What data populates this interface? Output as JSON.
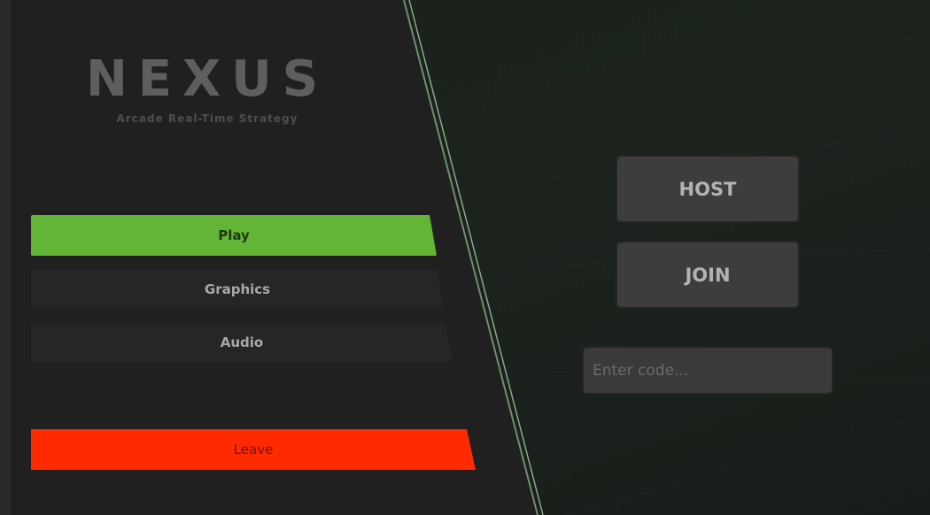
{
  "title": {
    "logo": "NEXUS",
    "subtitle": "Arcade Real-Time Strategy"
  },
  "menu": {
    "play_label": "Play",
    "graphics_label": "Graphics",
    "audio_label": "Audio",
    "leave_label": "Leave"
  },
  "lobby": {
    "host_label": "HOST",
    "join_label": "JOIN",
    "code_placeholder": "Enter code..."
  },
  "colors": {
    "play": "#63b536",
    "leave": "#ff2a00",
    "panel": "#202020",
    "divider": "#7a9a78"
  }
}
